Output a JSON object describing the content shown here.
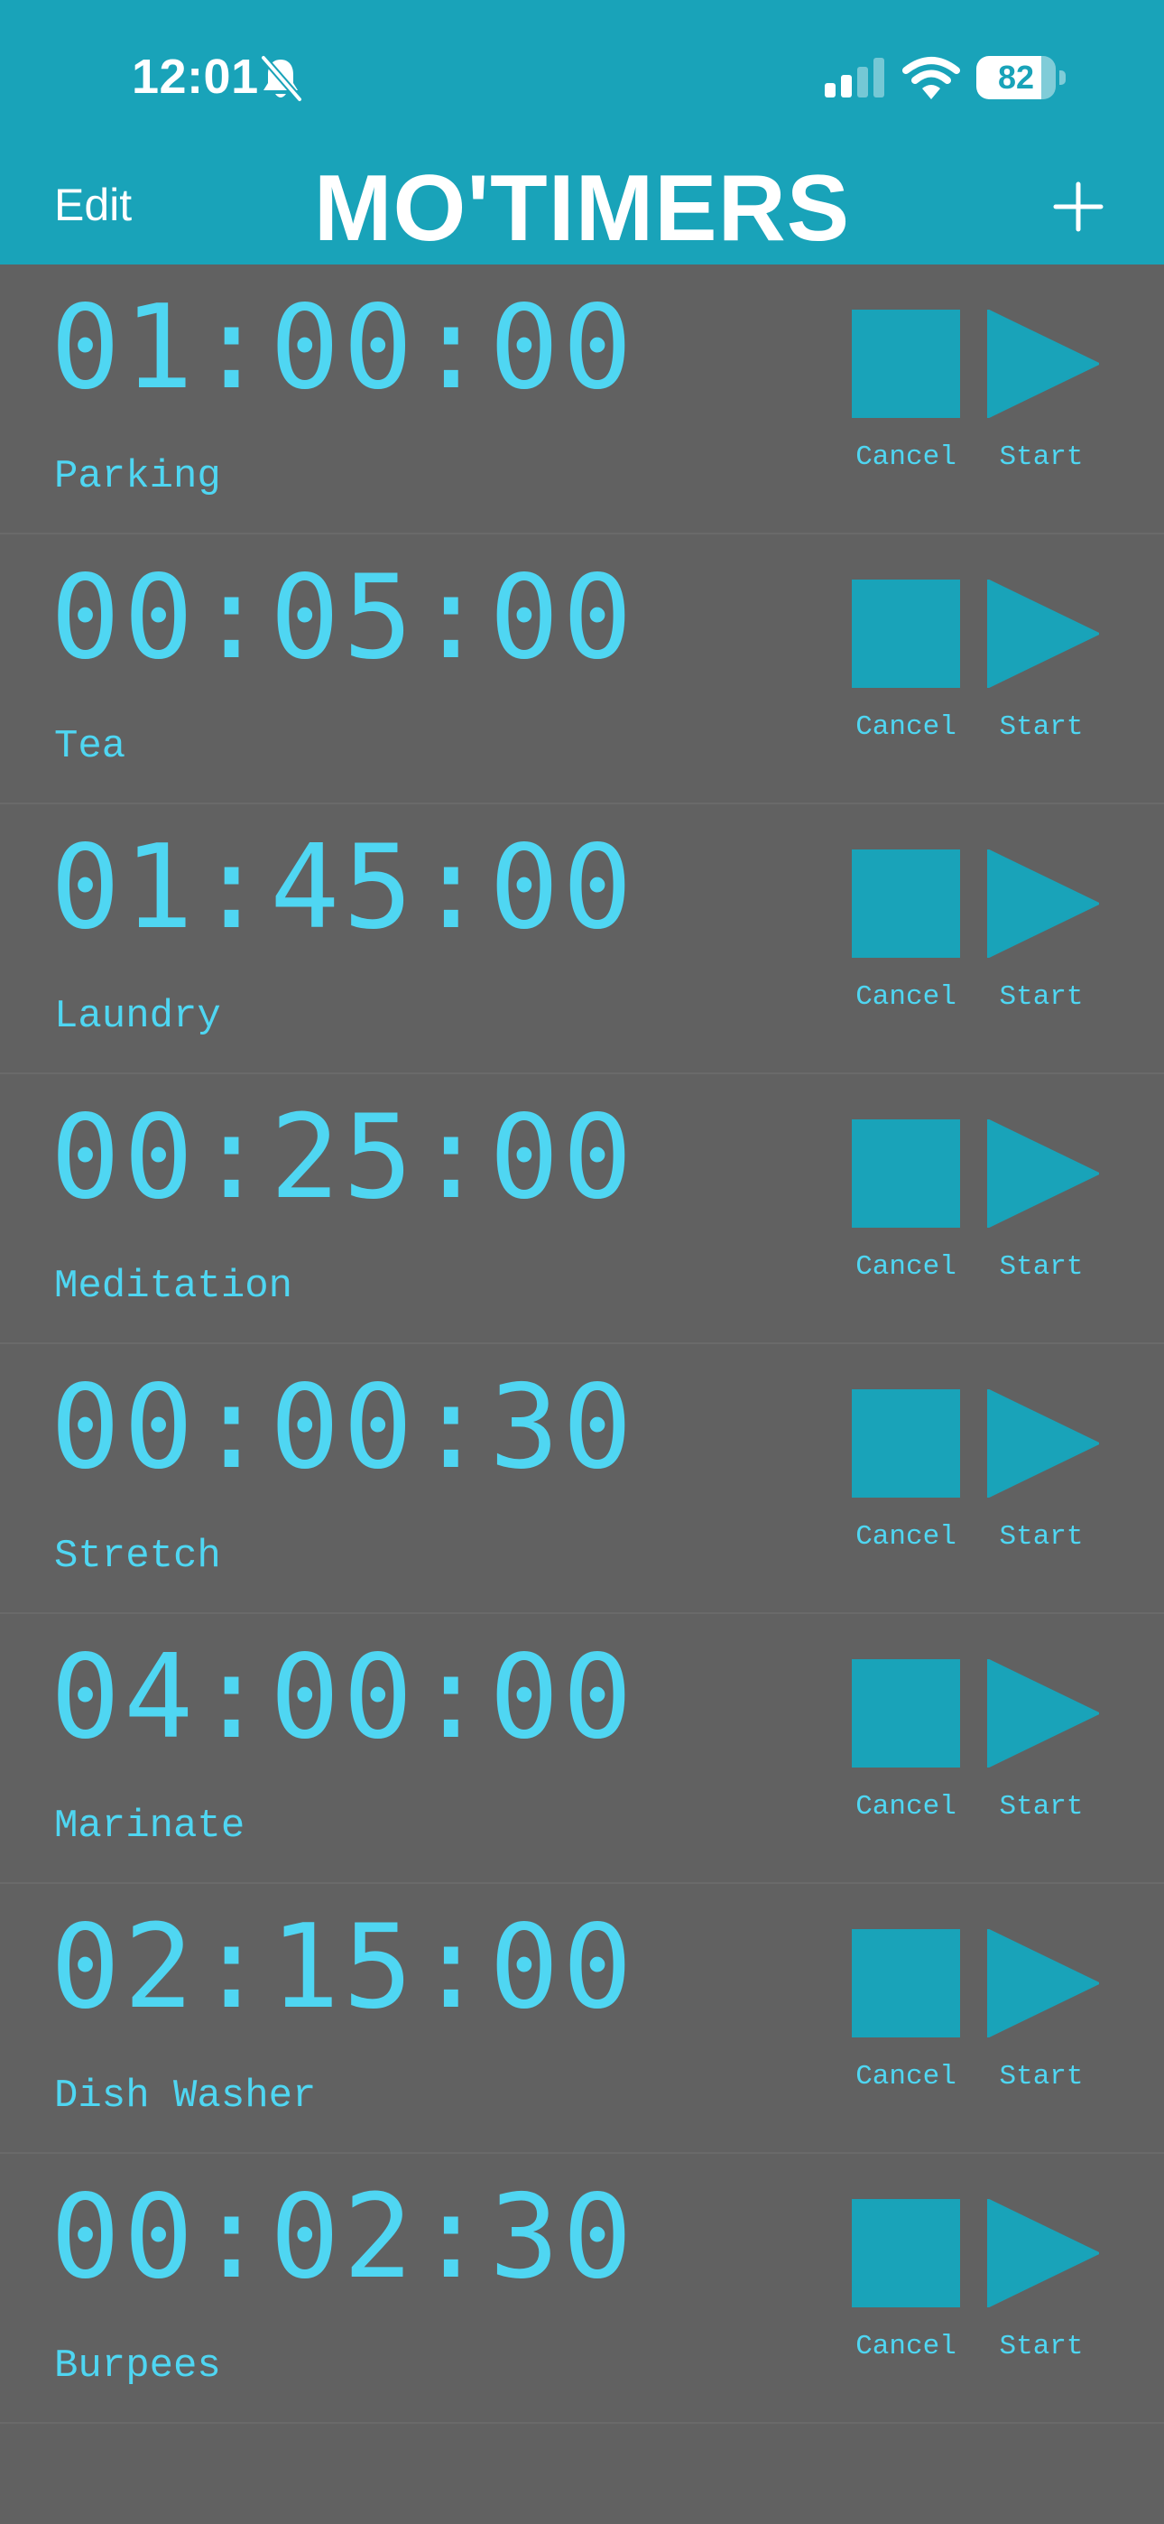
{
  "status_bar": {
    "time": "12:01",
    "battery_level": "82",
    "battery_fraction": 0.82,
    "icons": [
      "bell-slash-icon",
      "cellular-signal-icon",
      "wifi-icon",
      "battery-icon"
    ]
  },
  "nav": {
    "edit_label": "Edit",
    "title": "MO'TIMERS",
    "add_icon": "plus-icon"
  },
  "colors": {
    "accent": "#19a3b9",
    "text": "#4fd6f2",
    "background": "#616161"
  },
  "timers": [
    {
      "time": "01:00:00",
      "name": "Parking",
      "cancel_label": "Cancel",
      "start_label": "Start"
    },
    {
      "time": "00:05:00",
      "name": "Tea",
      "cancel_label": "Cancel",
      "start_label": "Start"
    },
    {
      "time": "01:45:00",
      "name": "Laundry",
      "cancel_label": "Cancel",
      "start_label": "Start"
    },
    {
      "time": "00:25:00",
      "name": "Meditation",
      "cancel_label": "Cancel",
      "start_label": "Start"
    },
    {
      "time": "00:00:30",
      "name": "Stretch",
      "cancel_label": "Cancel",
      "start_label": "Start"
    },
    {
      "time": "04:00:00",
      "name": "Marinate",
      "cancel_label": "Cancel",
      "start_label": "Start"
    },
    {
      "time": "02:15:00",
      "name": "Dish Washer",
      "cancel_label": "Cancel",
      "start_label": "Start"
    },
    {
      "time": "00:02:30",
      "name": "Burpees",
      "cancel_label": "Cancel",
      "start_label": "Start"
    }
  ]
}
